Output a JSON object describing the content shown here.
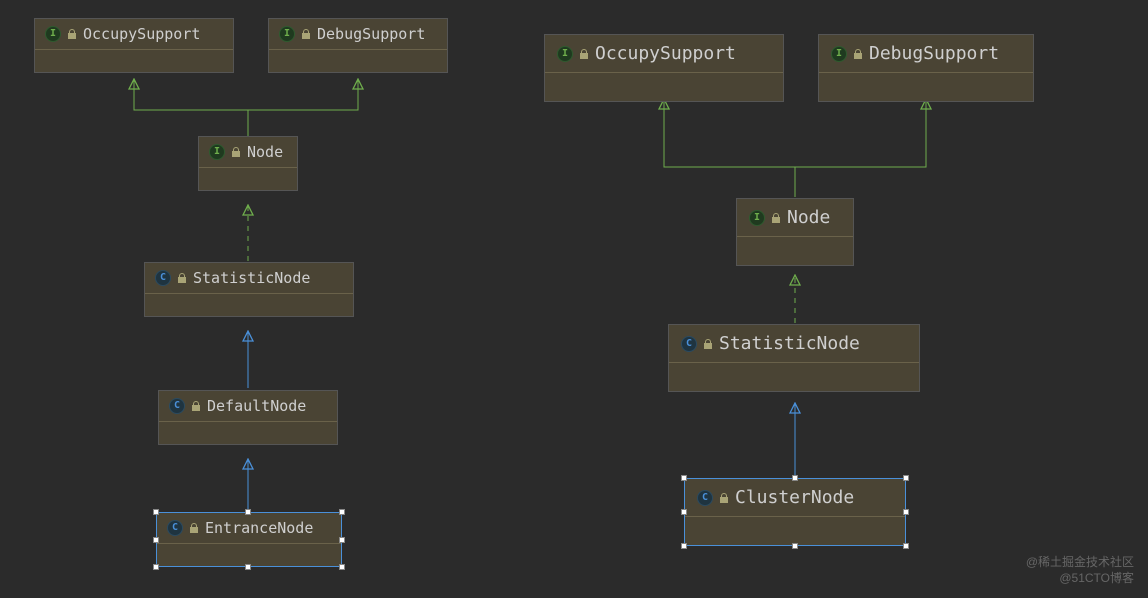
{
  "left": {
    "occupy": "OccupySupport",
    "debug": "DebugSupport",
    "node": "Node",
    "stat": "StatisticNode",
    "default": "DefaultNode",
    "entrance": "EntranceNode"
  },
  "right": {
    "occupy": "OccupySupport",
    "debug": "DebugSupport",
    "node": "Node",
    "stat": "StatisticNode",
    "cluster": "ClusterNode"
  },
  "colors": {
    "interface": "#6fae4c",
    "class": "#4a90d9",
    "select": "#4a90d9"
  },
  "watermarks": {
    "top": "@稀土掘金技术社区",
    "bottom": "@51CTO博客"
  },
  "diagram": {
    "description": "Two UML-style class hierarchies. Left: EntranceNode → DefaultNode → StatisticNode ⇢ Node ⇢ {OccupySupport, DebugSupport}. Right: ClusterNode → StatisticNode ⇢ Node ⇢ {OccupySupport, DebugSupport}. Solid blue arrows = class extension; dashed green arrows = interface implementation/extension.",
    "left_hierarchy": [
      {
        "from": "EntranceNode",
        "to": "DefaultNode",
        "kind": "extends"
      },
      {
        "from": "DefaultNode",
        "to": "StatisticNode",
        "kind": "extends"
      },
      {
        "from": "StatisticNode",
        "to": "Node",
        "kind": "implements"
      },
      {
        "from": "Node",
        "to": "OccupySupport",
        "kind": "extends-interface"
      },
      {
        "from": "Node",
        "to": "DebugSupport",
        "kind": "extends-interface"
      }
    ],
    "right_hierarchy": [
      {
        "from": "ClusterNode",
        "to": "StatisticNode",
        "kind": "extends"
      },
      {
        "from": "StatisticNode",
        "to": "Node",
        "kind": "implements"
      },
      {
        "from": "Node",
        "to": "OccupySupport",
        "kind": "extends-interface"
      },
      {
        "from": "Node",
        "to": "DebugSupport",
        "kind": "extends-interface"
      }
    ]
  }
}
